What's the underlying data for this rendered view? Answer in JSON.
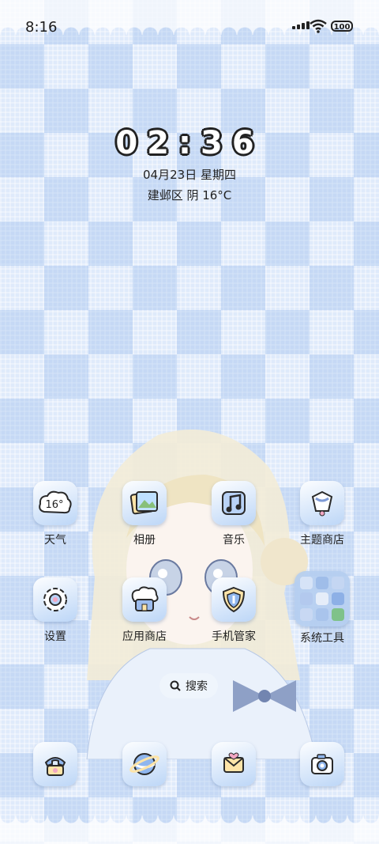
{
  "status_bar": {
    "time": "8:16",
    "battery": "100"
  },
  "widget": {
    "clock": "02:36",
    "date": "04月23日 星期四",
    "weather": "建邺区 阴 16°C"
  },
  "apps": {
    "weather": {
      "label": "天气",
      "icon_text": "16°",
      "icon": "cloud-weather-icon"
    },
    "album": {
      "label": "相册",
      "icon": "photo-album-icon"
    },
    "music": {
      "label": "音乐",
      "icon": "music-note-icon"
    },
    "theme_store": {
      "label": "主题商店",
      "icon": "theme-store-icon"
    },
    "settings": {
      "label": "设置",
      "icon": "gear-icon"
    },
    "app_store": {
      "label": "应用商店",
      "icon": "app-store-icon"
    },
    "phone_manager": {
      "label": "手机管家",
      "icon": "shield-icon"
    },
    "system_tools": {
      "label": "系统工具",
      "icon": "folder-icon"
    }
  },
  "search": {
    "label": "搜索"
  },
  "dock": {
    "phone": "phone-icon",
    "browser": "browser-icon",
    "messages": "message-icon",
    "camera": "camera-icon"
  },
  "colors": {
    "accent": "#8fb6ee",
    "background": "#dfeafb"
  }
}
